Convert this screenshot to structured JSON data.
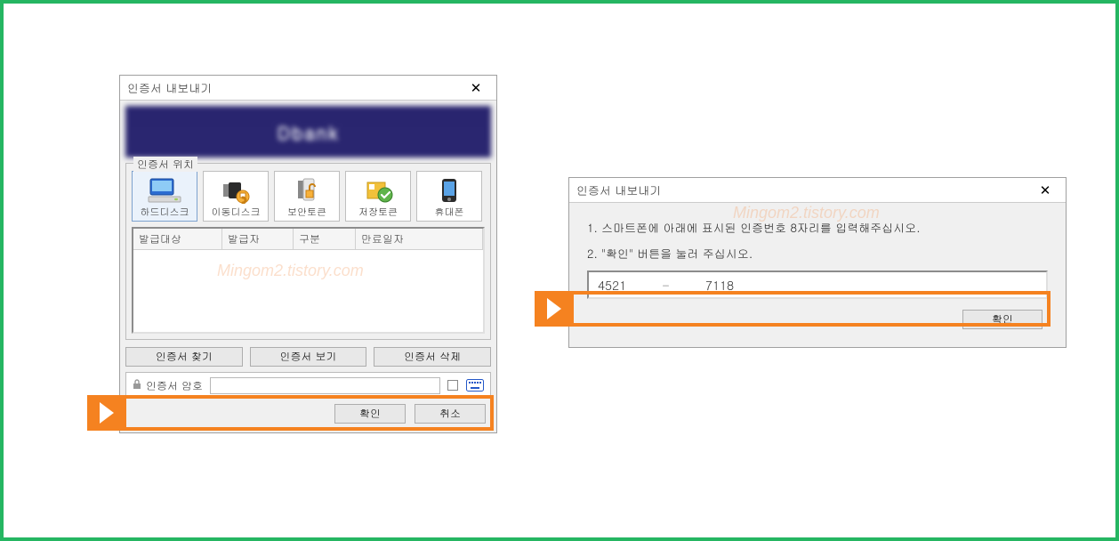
{
  "left_dialog": {
    "title": "인증서 내보내기",
    "close_tooltip": "닫기",
    "banner_text": "Dbank",
    "fieldset_legend": "인증서 위치",
    "locations": [
      {
        "name": "harddisk",
        "label": "하드디스크"
      },
      {
        "name": "movable",
        "label": "이동디스크"
      },
      {
        "name": "sectoken",
        "label": "보안토큰"
      },
      {
        "name": "savetoken",
        "label": "저장토큰"
      },
      {
        "name": "phone",
        "label": "휴대폰"
      }
    ],
    "columns": {
      "c1": "발급대상",
      "c2": "발급자",
      "c3": "구분",
      "c4": "만료일자"
    },
    "buttons": {
      "find": "인증서 찾기",
      "view": "인증서 보기",
      "del": "인증서 삭제"
    },
    "pw_label": "인증서 암호",
    "pw_value": "",
    "ok": "확인",
    "cancel": "취소"
  },
  "right_dialog": {
    "title": "인증서 내보내기",
    "close_tooltip": "닫기",
    "line1": "1. 스마트폰에 아래에 표시된 인증번호 8자리를 입력해주십시오.",
    "line2": "2. \"확인\" 버튼을 눌러 주십시오.",
    "code_a": "4521",
    "code_sep": "-",
    "code_b": "7118",
    "ok": "확인"
  },
  "watermark": "Mingom2.tistory.com",
  "colors": {
    "frame": "#25b662",
    "highlight": "#f58220",
    "banner": "#2a2670"
  }
}
